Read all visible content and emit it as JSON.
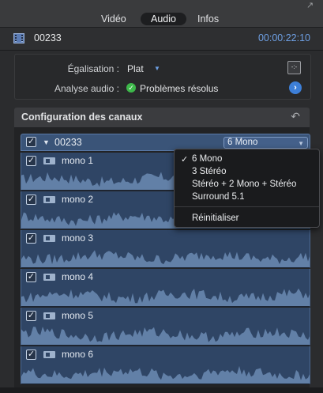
{
  "tabs": {
    "video": "Vidéo",
    "audio": "Audio",
    "info": "Infos"
  },
  "clip": {
    "name": "00233",
    "timecode": "00:00:22:10"
  },
  "settings": {
    "eq_label": "Égalisation :",
    "eq_value": "Plat",
    "analysis_label": "Analyse audio :",
    "analysis_value": "Problèmes résolus"
  },
  "channel_config": {
    "title": "Configuration des canaux",
    "group_name": "00233",
    "selected_config": "6 Mono",
    "channels": [
      "mono 1",
      "mono 2",
      "mono 3",
      "mono 4",
      "mono 5",
      "mono 6"
    ]
  },
  "menu": {
    "items": [
      "6 Mono",
      "3 Stéréo",
      "Stéréo + 2 Mono + Stéréo",
      "Surround 5.1"
    ],
    "reset": "Réinitialiser",
    "checked_index": 0
  },
  "colors": {
    "accent": "#6ea0e4",
    "channel_bg": "#2f4565",
    "waveform": "#6f8fb8"
  }
}
